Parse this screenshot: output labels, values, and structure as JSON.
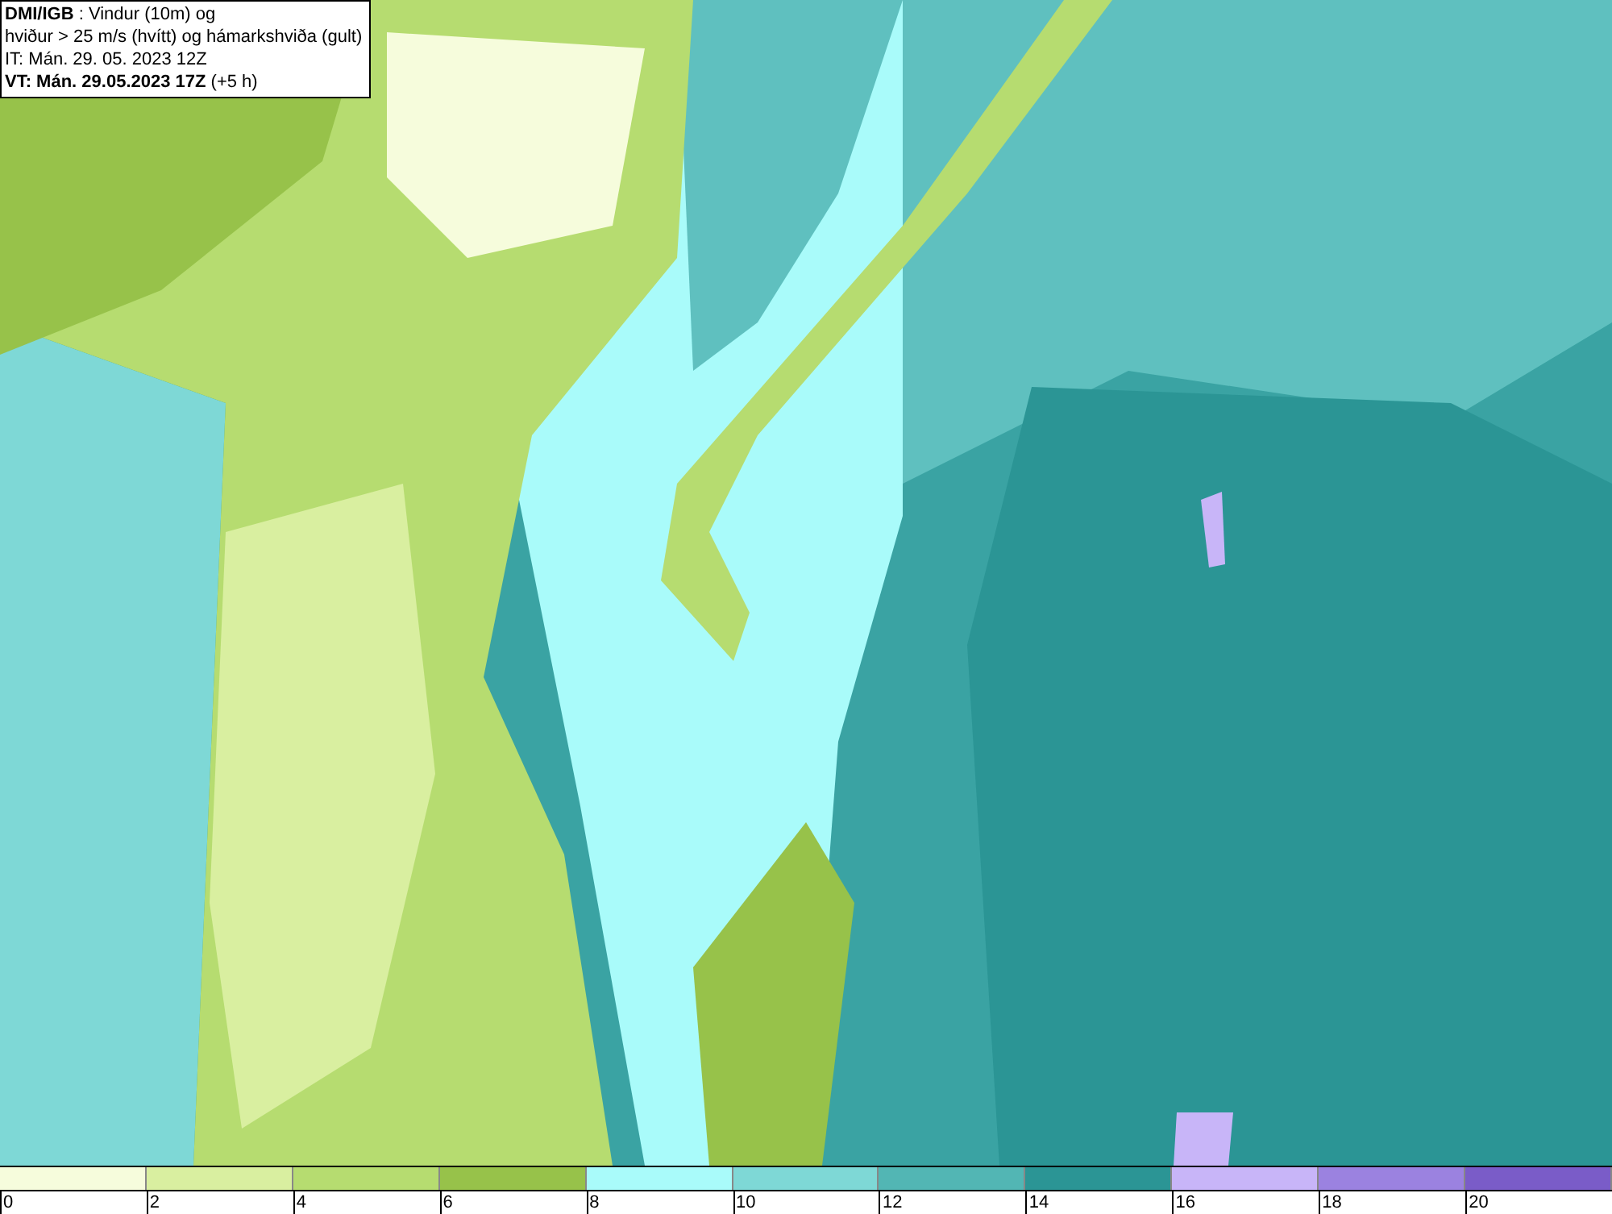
{
  "info_box": {
    "lines": [
      "**DMI/IGB** : Vindur (10m) og",
      "hviður > 25 m/s (hvítt) og hámarkshviða (gult)",
      "IT: Mán. 29. 05. 2023 12Z",
      "**VT: Mán. 29.05.2023 17Z** (+5 h)"
    ]
  },
  "legend": [
    {
      "label": "0",
      "color": "#f6fcdc"
    },
    {
      "label": "2",
      "color": "#d9efa0"
    },
    {
      "label": "4",
      "color": "#b6dc70"
    },
    {
      "label": "6",
      "color": "#97c24a"
    },
    {
      "label": "8",
      "color": "#a9fbfa"
    },
    {
      "label": "10",
      "color": "#7ed8d6"
    },
    {
      "label": "12",
      "color": "#52b6b4"
    },
    {
      "label": "14",
      "color": "#2b9595"
    },
    {
      "label": "16",
      "color": "#c8b5f8"
    },
    {
      "label": "18",
      "color": "#9b82e0"
    },
    {
      "label": "20",
      "color": "#7a5cc8"
    }
  ]
}
